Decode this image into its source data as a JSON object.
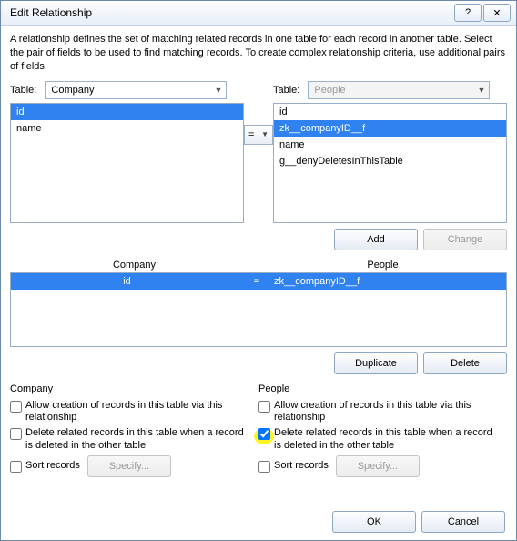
{
  "title": "Edit Relationship",
  "description": "A relationship defines the set of matching related records in one table for each record in another table. Select the pair of fields to be used to find matching records. To create complex relationship criteria, use additional pairs of fields.",
  "operator": "=",
  "left": {
    "table_label": "Table:",
    "table": "Company",
    "fields": [
      "id",
      "name"
    ],
    "opts_header": "Company"
  },
  "right": {
    "table_label": "Table:",
    "table": "People",
    "fields": [
      "id",
      "zk__companyID__f",
      "name",
      "g__denyDeletesInThisTable"
    ],
    "opts_header": "People"
  },
  "pairs": {
    "header_left": "Company",
    "header_right": "People",
    "rows": [
      {
        "left": "id",
        "op": "=",
        "right": "zk__companyID__f"
      }
    ]
  },
  "options": {
    "allow_creation": "Allow creation of records in this table via this relationship",
    "delete_related": "Delete related records in this table when a record is deleted in the other table",
    "sort": "Sort records"
  },
  "buttons": {
    "add": "Add",
    "change": "Change",
    "duplicate": "Duplicate",
    "delete": "Delete",
    "specify": "Specify...",
    "ok": "OK",
    "cancel": "Cancel"
  }
}
